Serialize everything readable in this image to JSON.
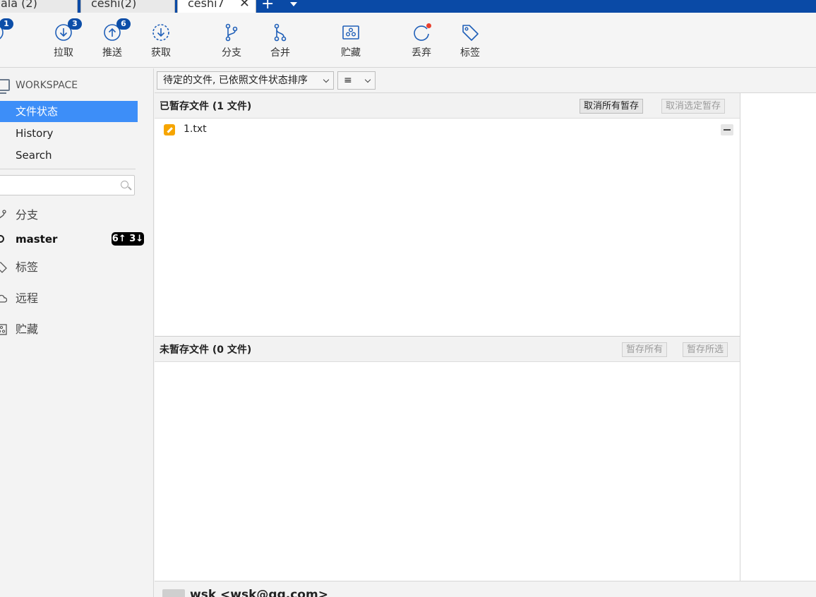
{
  "tabs": [
    {
      "label": "ala (2)"
    },
    {
      "label": "ceshi(2)"
    },
    {
      "label": "ceshi7",
      "active": true
    }
  ],
  "toolbar": {
    "commit": {
      "label": "交",
      "badge": "1"
    },
    "pull": {
      "label": "拉取",
      "badge": "3"
    },
    "push": {
      "label": "推送",
      "badge": "6"
    },
    "fetch": {
      "label": "获取"
    },
    "branch": {
      "label": "分支"
    },
    "merge": {
      "label": "合并"
    },
    "stash": {
      "label": "贮藏"
    },
    "discard": {
      "label": "丢弃"
    },
    "tag": {
      "label": "标签"
    }
  },
  "sidebar": {
    "workspace_header": "WORKSPACE",
    "items": [
      {
        "label": "文件状态",
        "selected": true
      },
      {
        "label": "History"
      },
      {
        "label": "Search"
      }
    ],
    "filter_placeholder": "",
    "groups": {
      "branches": "分支",
      "tags": "标签",
      "remotes": "远程",
      "stashes": "贮藏"
    },
    "current_branch": {
      "name": "master",
      "ahead_behind": "6↑ 3↓"
    }
  },
  "filterbar": {
    "sort_label": "待定的文件, 已依照文件状态排序",
    "view_icon": "≡"
  },
  "staged": {
    "title": "已暂存文件  (1 文件)",
    "unstage_all": "取消所有暂存",
    "unstage_selected": "取消选定暂存",
    "files": [
      {
        "name": "1.txt",
        "status": "modified"
      }
    ]
  },
  "unstaged": {
    "title": "未暂存文件  (0 文件)",
    "stage_all": "暂存所有",
    "stage_selected": "暂存所选"
  },
  "commit": {
    "author": "wsk <wsk@qq.com>"
  },
  "colors": {
    "accent": "#0a4aa6",
    "selection": "#3d8ef8",
    "badge": "#0c4ea8",
    "modified": "#f6a500"
  }
}
